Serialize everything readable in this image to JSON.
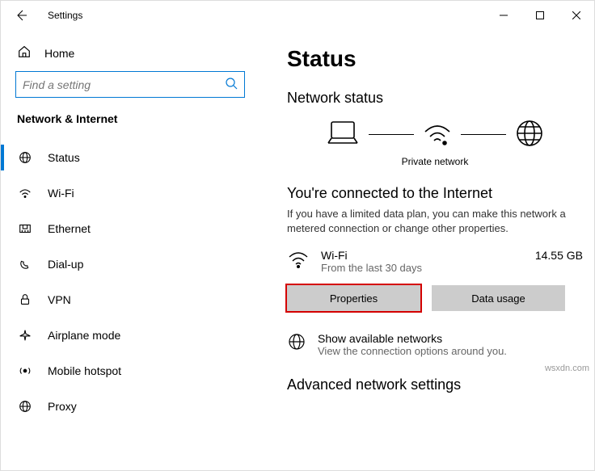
{
  "window": {
    "title": "Settings"
  },
  "sidebar": {
    "home": "Home",
    "search_placeholder": "Find a setting",
    "section": "Network & Internet",
    "items": [
      {
        "label": "Status"
      },
      {
        "label": "Wi-Fi"
      },
      {
        "label": "Ethernet"
      },
      {
        "label": "Dial-up"
      },
      {
        "label": "VPN"
      },
      {
        "label": "Airplane mode"
      },
      {
        "label": "Mobile hotspot"
      },
      {
        "label": "Proxy"
      }
    ]
  },
  "main": {
    "heading": "Status",
    "subheading": "Network status",
    "diagram_label": "Private network",
    "connected_title": "You're connected to the Internet",
    "connected_desc": "If you have a limited data plan, you can make this network a metered connection or change other properties.",
    "wifi": {
      "name": "Wi-Fi",
      "sub": "From the last 30 days",
      "usage": "14.55 GB"
    },
    "buttons": {
      "properties": "Properties",
      "data_usage": "Data usage"
    },
    "available": {
      "title": "Show available networks",
      "sub": "View the connection options around you."
    },
    "advanced": "Advanced network settings"
  },
  "watermark": "wsxdn.com"
}
